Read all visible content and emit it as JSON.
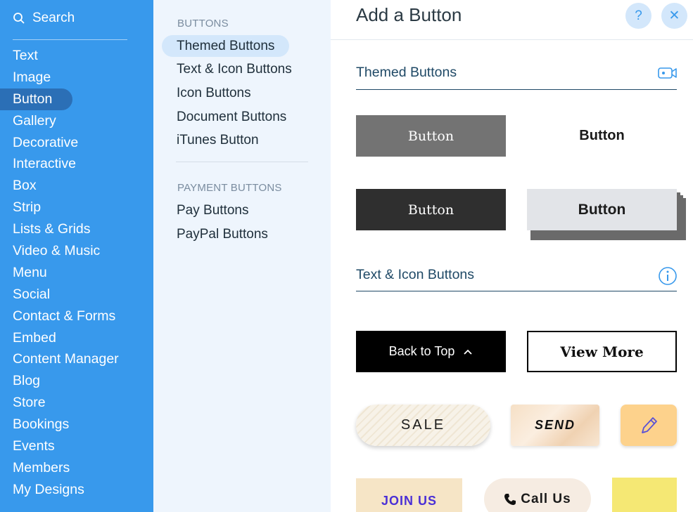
{
  "sidebar": {
    "search_label": "Search",
    "items": [
      {
        "label": "Text"
      },
      {
        "label": "Image"
      },
      {
        "label": "Button",
        "active": true
      },
      {
        "label": "Gallery"
      },
      {
        "label": "Decorative"
      },
      {
        "label": "Interactive"
      },
      {
        "label": "Box"
      },
      {
        "label": "Strip"
      },
      {
        "label": "Lists & Grids"
      },
      {
        "label": "Video & Music"
      },
      {
        "label": "Menu"
      },
      {
        "label": "Social"
      },
      {
        "label": "Contact & Forms"
      },
      {
        "label": "Embed"
      },
      {
        "label": "Content Manager"
      },
      {
        "label": "Blog"
      },
      {
        "label": "Store"
      },
      {
        "label": "Bookings"
      },
      {
        "label": "Events"
      },
      {
        "label": "Members"
      },
      {
        "label": "My Designs"
      }
    ]
  },
  "submenu": {
    "buttons_header": "BUTTONS",
    "buttons_items": [
      {
        "label": "Themed Buttons",
        "active": true
      },
      {
        "label": "Text & Icon Buttons"
      },
      {
        "label": "Icon Buttons"
      },
      {
        "label": "Document Buttons"
      },
      {
        "label": "iTunes Button"
      }
    ],
    "payment_header": "PAYMENT BUTTONS",
    "payment_items": [
      {
        "label": "Pay Buttons"
      },
      {
        "label": "PayPal Buttons"
      }
    ]
  },
  "panel": {
    "title": "Add a Button",
    "help_label": "?",
    "close_label": "✕",
    "themed_section": {
      "title": "Themed Buttons",
      "icon": "video-icon",
      "buttons": [
        "Button",
        "Button",
        "Button",
        "Button"
      ]
    },
    "text_icon_section": {
      "title": "Text & Icon Buttons",
      "icon": "info-icon",
      "back_to_top": "Back to Top",
      "view_more": "View More",
      "sale": "SALE",
      "send": "SEND",
      "join_us": "JOIN US",
      "call_us": "Call Us"
    }
  },
  "colors": {
    "sidebar_bg": "#3899ec",
    "submenu_bg": "#eef5fd",
    "accent": "#3899ec",
    "section_title": "#1f4966"
  }
}
